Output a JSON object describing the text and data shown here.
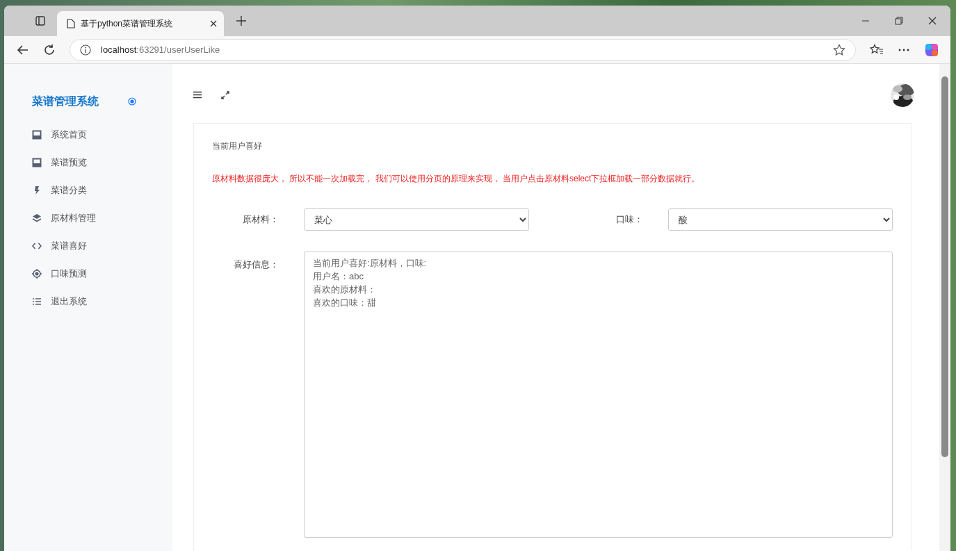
{
  "browser": {
    "tab_title": "基于python菜谱管理系统",
    "url_host": "localhost",
    "url_rest": ":63291/userUserLike"
  },
  "sidebar": {
    "title": "菜谱管理系统",
    "items": [
      {
        "label": "系统首页"
      },
      {
        "label": "菜谱预览"
      },
      {
        "label": "菜谱分类"
      },
      {
        "label": "原材料管理"
      },
      {
        "label": "菜谱喜好"
      },
      {
        "label": "口味预测"
      },
      {
        "label": "退出系统"
      }
    ]
  },
  "content": {
    "title": "当前用户喜好",
    "notice": "原材料数据很庞大， 所以不能一次加载完， 我们可以使用分页的原理来实现， 当用户点击原材料select下拉框加载一部分数据就行。",
    "material": {
      "label": "原材料：",
      "value": "菜心"
    },
    "taste": {
      "label": "口味：",
      "value": "酸"
    },
    "info": {
      "label": "喜好信息：",
      "lines": [
        "当前用户喜好:原材料，口味:",
        "用户名：abc",
        "喜欢的原材料：",
        "喜欢的口味：甜"
      ]
    }
  }
}
